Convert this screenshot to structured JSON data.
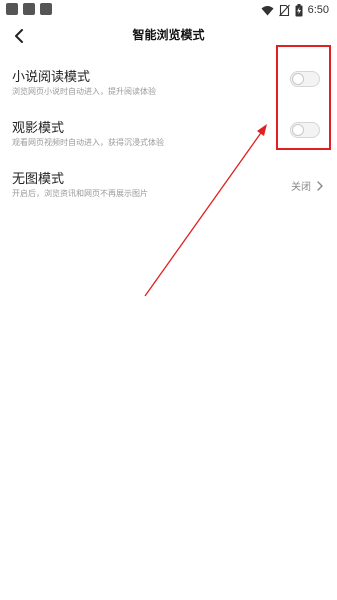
{
  "status_bar": {
    "time": "6:50",
    "icons": [
      "notification-square-icon",
      "notification-square-icon",
      "notification-square-icon",
      "wifi-icon",
      "no-sim-icon",
      "battery-charging-icon"
    ]
  },
  "header": {
    "back_icon": "chevron-left-icon",
    "title": "智能浏览模式"
  },
  "settings": [
    {
      "title": "小说阅读模式",
      "desc": "浏览网页小说时自动进入，提升阅读体验",
      "control": "toggle",
      "on": false
    },
    {
      "title": "观影模式",
      "desc": "观看网页视频时自动进入，获得沉浸式体验",
      "control": "toggle",
      "on": false
    },
    {
      "title": "无图模式",
      "desc": "开启后，浏览资讯和网页不再展示图片",
      "control": "value",
      "value": "关闭",
      "chevron_icon": "chevron-right-icon"
    }
  ],
  "annotation": {
    "highlight_color": "#e02020"
  }
}
